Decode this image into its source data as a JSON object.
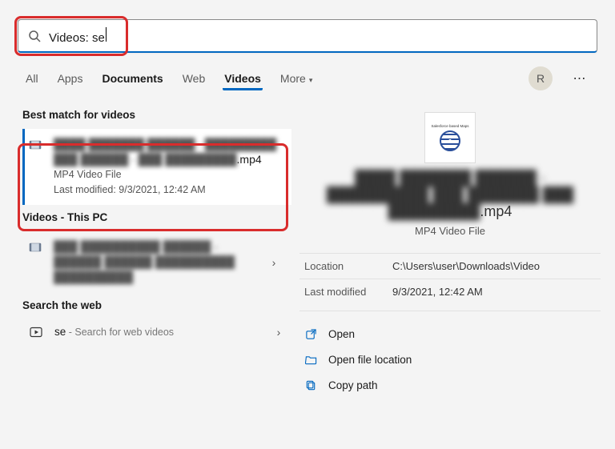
{
  "search": {
    "prefix": "Videos: ",
    "query": "se"
  },
  "tabs": {
    "all": "All",
    "apps": "Apps",
    "documents": "Documents",
    "web": "Web",
    "videos": "Videos",
    "more": "More"
  },
  "user_initial": "R",
  "left": {
    "best_match_header": "Best match for videos",
    "best_match": {
      "title_blurred": "████ ███████ ██████ - █████████ ███ ██████ - ███ █████████",
      "ext": ".mp4",
      "type_line": "MP4 Video File",
      "modified_line": "Last modified: 9/3/2021, 12:42 AM"
    },
    "videos_pc_header": "Videos - This PC",
    "videos_pc_item": {
      "title_blurred": "███ ██████████ ██████ - ██████ ██████ ██████████ ██████████"
    },
    "web_header": "Search the web",
    "web_item": {
      "query": "se",
      "hint": " - Search for web videos"
    }
  },
  "detail": {
    "title_blurred": "████ ███████ ██████ - ██████████ ███ ███████ ███ █████████",
    "ext": ".mp4",
    "type": "MP4 Video File",
    "thumb_caption": "Salesforce based Maps",
    "location_label": "Location",
    "location_value": "C:\\Users\\user\\Downloads\\Video",
    "modified_label": "Last modified",
    "modified_value": "9/3/2021, 12:42 AM",
    "actions": {
      "open": "Open",
      "open_loc": "Open file location",
      "copy_path": "Copy path"
    }
  }
}
